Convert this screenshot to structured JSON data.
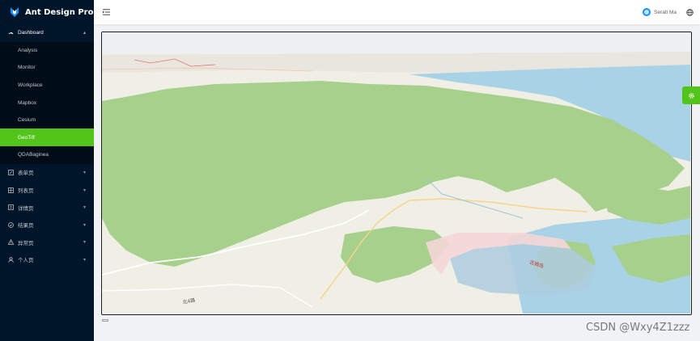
{
  "app": {
    "title": "Ant Design Pro"
  },
  "sidebar": {
    "dashboard": {
      "label": "Dashboard",
      "items": [
        {
          "label": "Analysis"
        },
        {
          "label": "Monitor"
        },
        {
          "label": "Workplace"
        },
        {
          "label": "Mapbox"
        },
        {
          "label": "Cesium"
        },
        {
          "label": "GeoTiff"
        },
        {
          "label": "QDABaginea"
        }
      ],
      "active": "GeoTiff"
    },
    "menus": [
      {
        "label": "表单页",
        "icon": "form-icon"
      },
      {
        "label": "列表页",
        "icon": "table-icon"
      },
      {
        "label": "详情页",
        "icon": "profile-icon"
      },
      {
        "label": "结果页",
        "icon": "check-circle-icon"
      },
      {
        "label": "异常页",
        "icon": "warning-icon"
      },
      {
        "label": "个人页",
        "icon": "user-icon"
      }
    ]
  },
  "header": {
    "username": "Serati Ma"
  },
  "map": {
    "labels": {
      "a": "吉姆岛",
      "b": "北4路"
    }
  },
  "colors": {
    "accent": "#52c41a",
    "sider": "#001529",
    "water": "#a8d3e6",
    "land": "#eef0e6",
    "forest": "#a7d08c"
  },
  "watermark": "CSDN @Wxy4Z1zzz"
}
